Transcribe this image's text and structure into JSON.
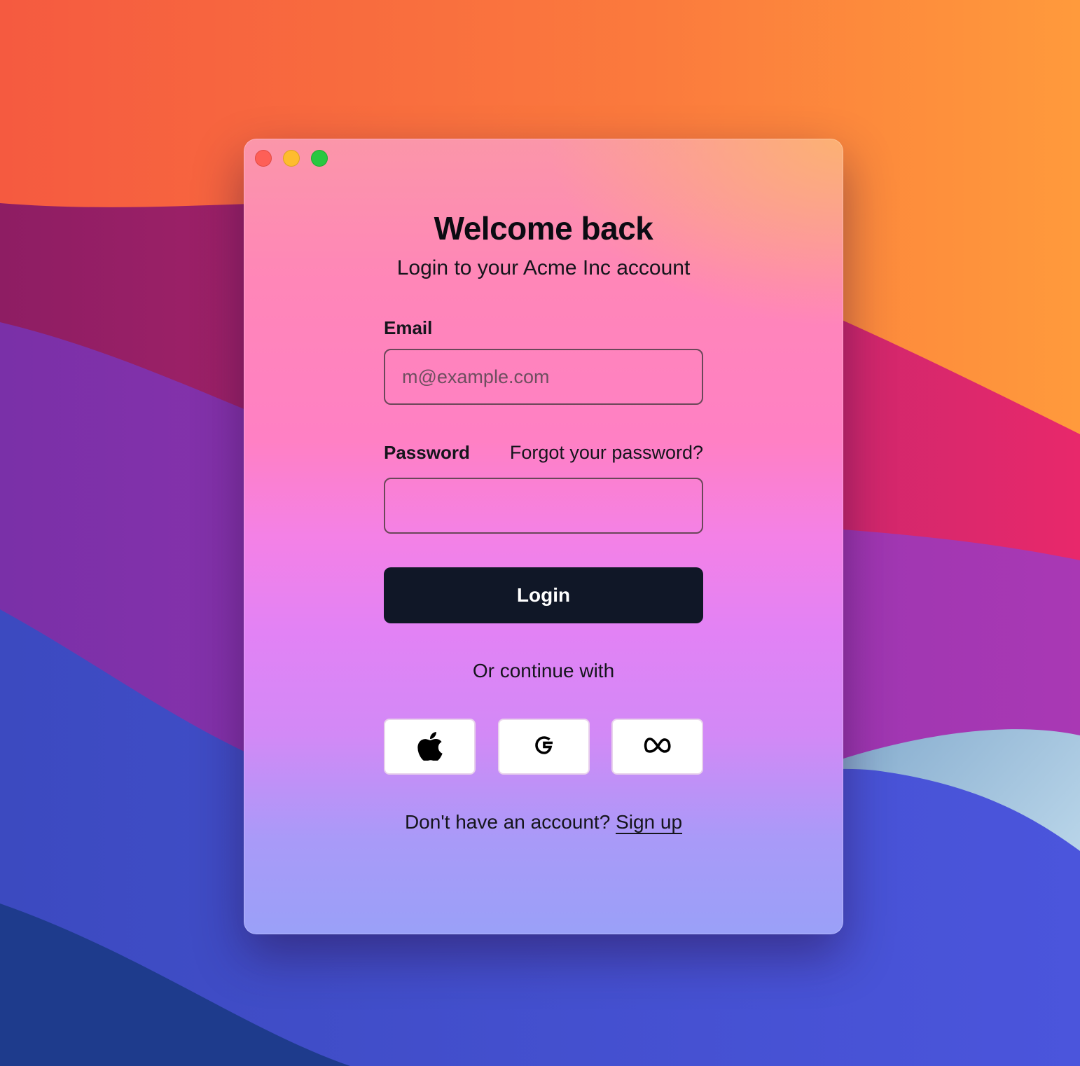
{
  "window": {
    "controls": [
      "close",
      "minimize",
      "maximize"
    ]
  },
  "login": {
    "title": "Welcome back",
    "subtitle": "Login to your Acme Inc account",
    "email_label": "Email",
    "email_placeholder": "m@example.com",
    "email_value": "",
    "password_label": "Password",
    "password_value": "",
    "forgot_password": "Forgot your password?",
    "login_button": "Login",
    "divider": "Or continue with",
    "social": [
      {
        "provider": "Apple",
        "icon": "apple-icon"
      },
      {
        "provider": "Google",
        "icon": "google-icon"
      },
      {
        "provider": "Meta",
        "icon": "meta-icon"
      }
    ],
    "signup_prompt": "Don't have an account?",
    "signup_link": "Sign up"
  },
  "colors": {
    "button_bg": "#101727",
    "close": "#fe5f57",
    "minimize": "#febc2e",
    "maximize": "#28c840"
  }
}
